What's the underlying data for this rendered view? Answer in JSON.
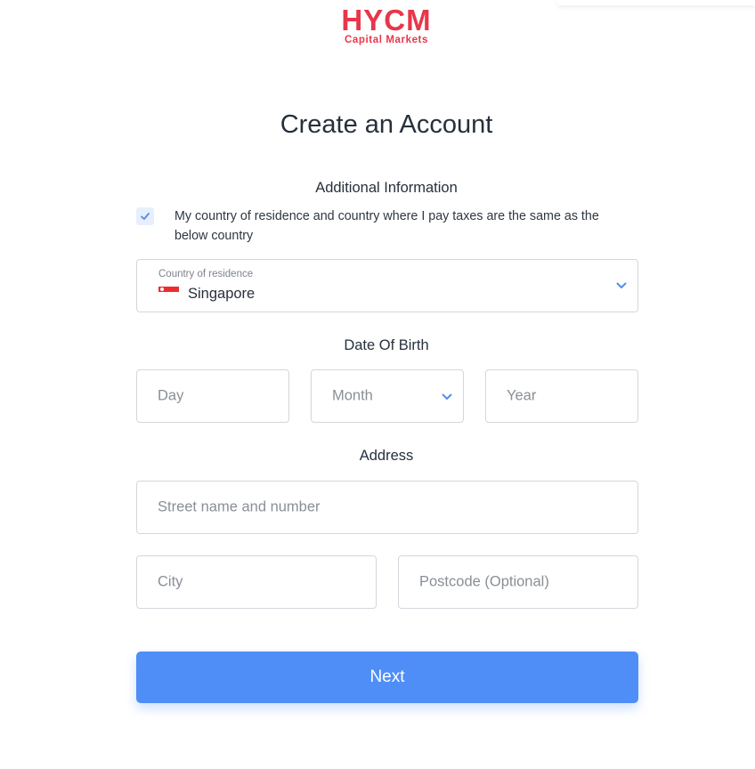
{
  "logo": {
    "mark": "HYCM",
    "sub": "Capital Markets"
  },
  "title": "Create an Account",
  "sections": {
    "additional_info": "Additional Information",
    "date_of_birth": "Date Of Birth",
    "address": "Address"
  },
  "tax_checkbox": {
    "checked": true,
    "label": "My country of residence and country where I pay taxes are the same as the below country"
  },
  "country": {
    "label": "Country of residence",
    "value": "Singapore",
    "flag_icon": "singapore-flag-icon"
  },
  "dob": {
    "day_placeholder": "Day",
    "month_placeholder": "Month",
    "year_placeholder": "Year"
  },
  "address": {
    "street_placeholder": "Street name and number",
    "city_placeholder": "City",
    "postcode_placeholder": "Postcode (Optional)"
  },
  "next_button": "Next",
  "colors": {
    "brand": "#e8364a",
    "accent": "#4f8ef7",
    "checkbox_bg": "#e6effb"
  }
}
